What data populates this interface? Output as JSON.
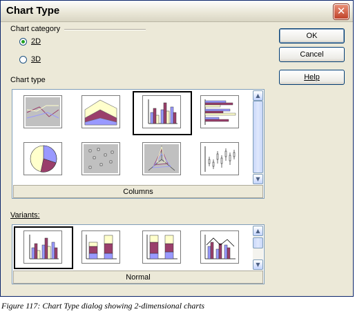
{
  "window": {
    "title": "Chart Type"
  },
  "chart_category": {
    "heading": "Chart category",
    "options": [
      {
        "label": "2D",
        "selected": true
      },
      {
        "label": "3D",
        "selected": false
      }
    ]
  },
  "buttons": {
    "ok": "OK",
    "cancel": "Cancel",
    "help": "Help"
  },
  "chart_type": {
    "heading": "Chart type",
    "selected_name": "Columns",
    "icons": [
      "lines-icon",
      "areas-icon",
      "columns-icon",
      "bars-icon",
      "pie-icon",
      "xy-scatter-icon",
      "net-icon",
      "stock-icon"
    ],
    "selected_index": 2
  },
  "variants": {
    "heading": "Variants:",
    "selected_name": "Normal",
    "icons": [
      "normal-columns-icon",
      "stacked-columns-icon",
      "percent-stacked-columns-icon",
      "columns-and-lines-icon"
    ],
    "selected_index": 0
  },
  "figure_caption": "Figure 117: Chart Type dialog showing 2-dimensional charts",
  "colors": {
    "purple": "#9a3f6b",
    "lavender": "#9999ff",
    "cream": "#ffffcc",
    "gray_bg": "#c0c0c0"
  }
}
